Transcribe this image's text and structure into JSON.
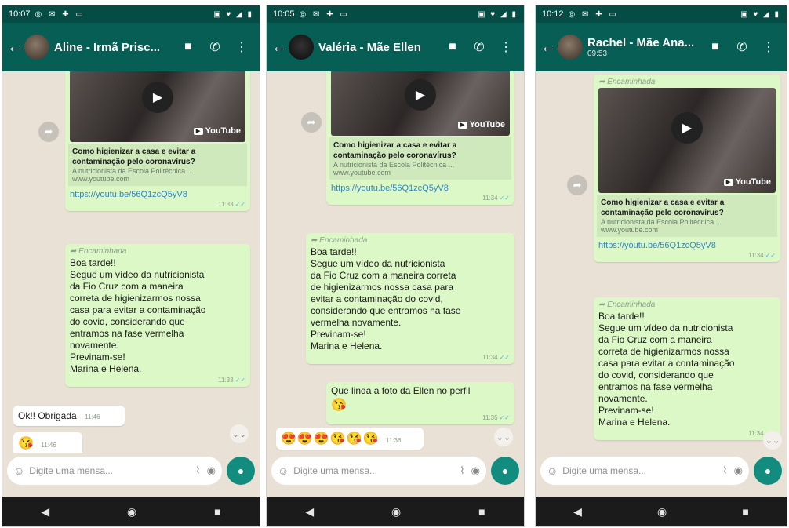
{
  "icons": {
    "back": "←",
    "video": "■",
    "call": "✆",
    "more": "⋮",
    "play": "▶",
    "share": "➦",
    "scroll": "⌄⌄",
    "emoji": "☺",
    "attach": "⌇",
    "camera": "◉",
    "mic": "●",
    "nav_back": "◀",
    "nav_home": "◉",
    "nav_recent": "■",
    "status_left": "◎ ✉ ✚ ▭",
    "status_right": "▣ ♥ ◢ ▮",
    "yt_logo": "▶"
  },
  "common": {
    "youtube_label": "YouTube",
    "video_title": "Como higienizar a casa e evitar a contaminação pelo coronavírus?",
    "video_desc": "A nutricionista da Escola Politécnica ...",
    "video_site": "www.youtube.com",
    "link": "https://youtu.be/56Q1zcQ5yV8",
    "forwarded": "Encaminhada",
    "message_lines": [
      "Boa tarde!!",
      "Segue um vídeo da nutricionista",
      "da Fio Cruz com a maneira",
      "correta de higienizarmos nossa",
      "casa para evitar a contaminação",
      "do covid, considerando que",
      "entramos na fase vermelha",
      "novamente.",
      "Previnam-se!",
      "Marina e Helena."
    ],
    "input_placeholder": "Digite uma mensa..."
  },
  "panel1": {
    "status_time": "10:07",
    "contact": "Aline - Irmã Prisc...",
    "link_time": "11:33",
    "msg_time": "11:33",
    "reply_text": "Ok!! Obrigada",
    "reply_time": "11:46",
    "emoji": "😘",
    "emoji_time": "11:46"
  },
  "panel2": {
    "status_time": "10:05",
    "contact": "Valéria - Mãe Ellen",
    "link_time": "11:34",
    "msg_lines": [
      "Boa tarde!!",
      "Segue um vídeo da nutricionista",
      "da Fio Cruz com a maneira correta",
      "de higienizarmos nossa casa para",
      "evitar a contaminação do covid,",
      "considerando que entramos na fase",
      "vermelha novamente.",
      "Previnam-se!",
      "Marina e Helena."
    ],
    "msg_time": "11:34",
    "out_text": "Que linda a foto da Ellen no perfil",
    "out_emoji": "😘",
    "out_time": "11:35",
    "in_emojis": "😍😍😍😘😘😘",
    "in_time": "11:36"
  },
  "panel3": {
    "status_time": "10:12",
    "contact": "Rachel - Mãe Ana...",
    "subtitle": "09:53",
    "link_time": "11:34",
    "msg_time": "11:34"
  },
  "colors": {
    "header": "#075e54",
    "statusbar": "#054d44",
    "bubble_out": "#dcf8c6",
    "bubble_in": "#ffffff",
    "chat_bg": "#e9e1d6",
    "link": "#2f86c8",
    "mic": "#128c7e"
  }
}
